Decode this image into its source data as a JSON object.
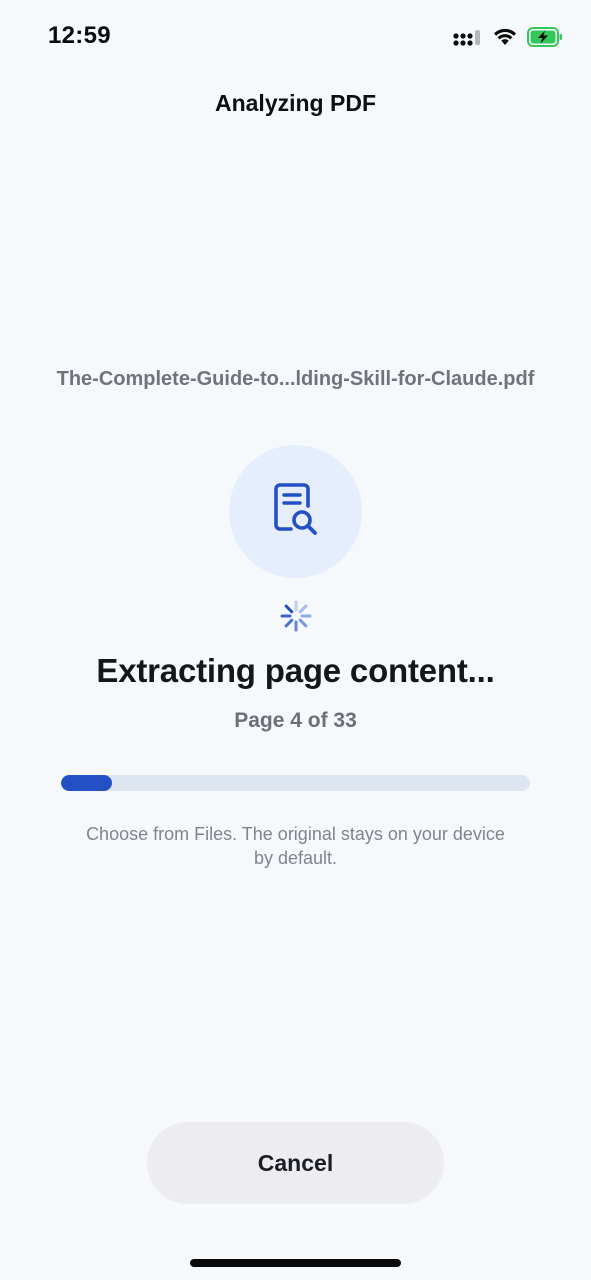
{
  "status_bar": {
    "time": "12:59",
    "icons": [
      "cellular-signal-icon",
      "wifi-icon",
      "battery-charging-icon"
    ],
    "battery_color": "#34c759"
  },
  "nav": {
    "title": "Analyzing PDF"
  },
  "file": {
    "name": "The-Complete-Guide-to...lding-Skill-for-Claude.pdf",
    "icon": "document-search-icon"
  },
  "progress": {
    "spinner_icon": "loading-spinner-icon",
    "headline": "Extracting page content...",
    "page_label": "Page 4 of 33",
    "current_page": 4,
    "total_pages": 33,
    "fraction": 0.108,
    "fill_color": "#2350c4",
    "track_color": "#dde5f0"
  },
  "helper": {
    "text": "Choose from Files. The original stays on your device by default."
  },
  "actions": {
    "cancel_label": "Cancel"
  }
}
